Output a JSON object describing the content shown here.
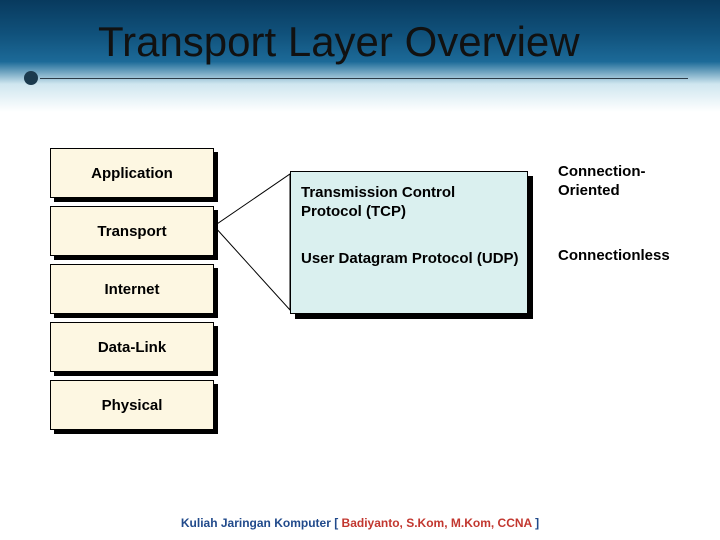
{
  "title": "Transport Layer Overview",
  "layers": {
    "application": "Application",
    "transport": "Transport",
    "internet": "Internet",
    "datalink": "Data-Link",
    "physical": "Physical"
  },
  "protocols": {
    "tcp": "Transmission Control Protocol (TCP)",
    "udp": "User Datagram Protocol (UDP)"
  },
  "annotations": {
    "connection_oriented": "Connection-Oriented",
    "connectionless": "Connectionless"
  },
  "footer": {
    "left": "Kuliah Jaringan Komputer [ ",
    "name": "Badiyanto, S.Kom, M.Kom, CCNA",
    "right": " ]"
  }
}
